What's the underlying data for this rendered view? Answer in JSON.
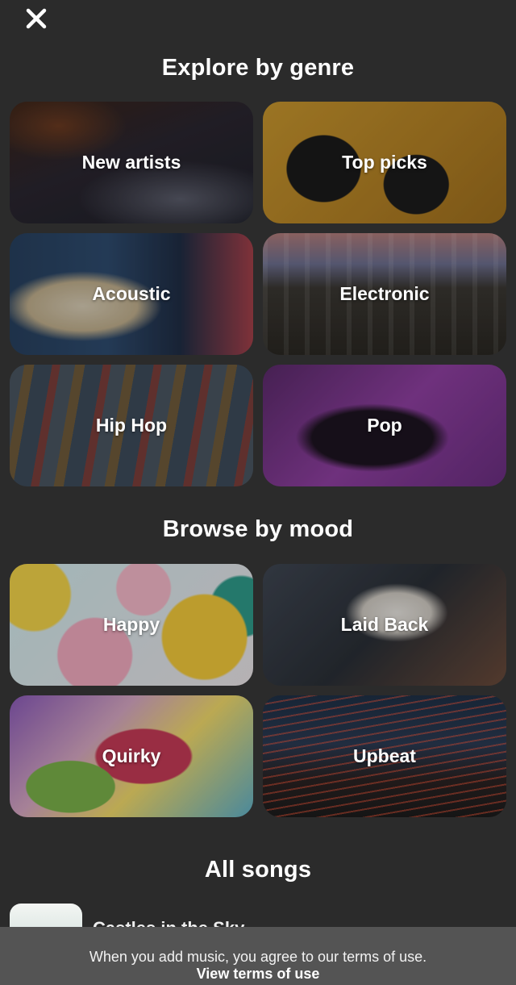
{
  "header": {
    "close_icon": "close-icon"
  },
  "genre_section": {
    "title": "Explore by genre",
    "tiles": [
      {
        "label": "New artists"
      },
      {
        "label": "Top picks"
      },
      {
        "label": "Acoustic"
      },
      {
        "label": "Electronic"
      },
      {
        "label": "Hip Hop"
      },
      {
        "label": "Pop"
      }
    ]
  },
  "mood_section": {
    "title": "Browse by mood",
    "tiles": [
      {
        "label": "Happy"
      },
      {
        "label": "Laid Back"
      },
      {
        "label": "Quirky"
      },
      {
        "label": "Upbeat"
      }
    ]
  },
  "songs_section": {
    "title": "All songs",
    "first_song": "Castles in the Sky"
  },
  "terms": {
    "text": "When you add music, you agree to our terms of use.",
    "link": "View terms of use"
  },
  "colors": {
    "background": "#2b2b2b",
    "terms_bar": "#545454"
  }
}
